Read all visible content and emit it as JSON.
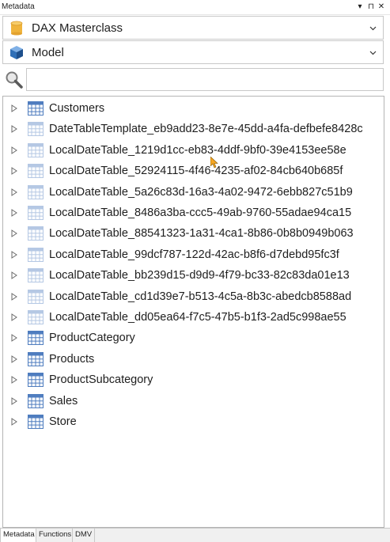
{
  "panel": {
    "title": "Metadata",
    "dropdown_glyph": "▾",
    "pin_glyph": "⊓",
    "close_glyph": "✕"
  },
  "database_selector": {
    "value": "DAX Masterclass",
    "icon": "database-icon"
  },
  "model_selector": {
    "value": "Model",
    "icon": "cube-icon"
  },
  "search": {
    "placeholder": "",
    "value": ""
  },
  "tree": {
    "items": [
      {
        "label": "Customers"
      },
      {
        "label": "DateTableTemplate_eb9add23-8e7e-45dd-a4fa-defbefe8428c"
      },
      {
        "label": "LocalDateTable_1219d1cc-eb83-4ddf-9bf0-39e4153ee58e"
      },
      {
        "label": "LocalDateTable_52924115-4f46-4235-af02-84cb640b685f"
      },
      {
        "label": "LocalDateTable_5a26c83d-16a3-4a02-9472-6ebb827c51b9"
      },
      {
        "label": "LocalDateTable_8486a3ba-ccc5-49ab-9760-55adae94ca15"
      },
      {
        "label": "LocalDateTable_88541323-1a31-4ca1-8b86-0b8b0949b063"
      },
      {
        "label": "LocalDateTable_99dcf787-122d-42ac-b8f6-d7debd95fc3f"
      },
      {
        "label": "LocalDateTable_bb239d15-d9d9-4f79-bc33-82c83da01e13"
      },
      {
        "label": "LocalDateTable_cd1d39e7-b513-4c5a-8b3c-abedcb8588ad"
      },
      {
        "label": "LocalDateTable_dd05ea64-f7c5-47b5-b1f3-2ad5c998ae55"
      },
      {
        "label": "ProductCategory"
      },
      {
        "label": "Products"
      },
      {
        "label": "ProductSubcategory"
      },
      {
        "label": "Sales"
      },
      {
        "label": "Store"
      }
    ]
  },
  "tabs": [
    {
      "label": "Metadata",
      "active": true
    },
    {
      "label": "Functions",
      "active": false
    },
    {
      "label": "DMV",
      "active": false
    }
  ],
  "colors": {
    "database_icon": "#f0b43c",
    "cube_icon": "#2f6fb7",
    "table_icon": "#4f7dbf",
    "hidden_table_icon": "#b5c8e4"
  }
}
